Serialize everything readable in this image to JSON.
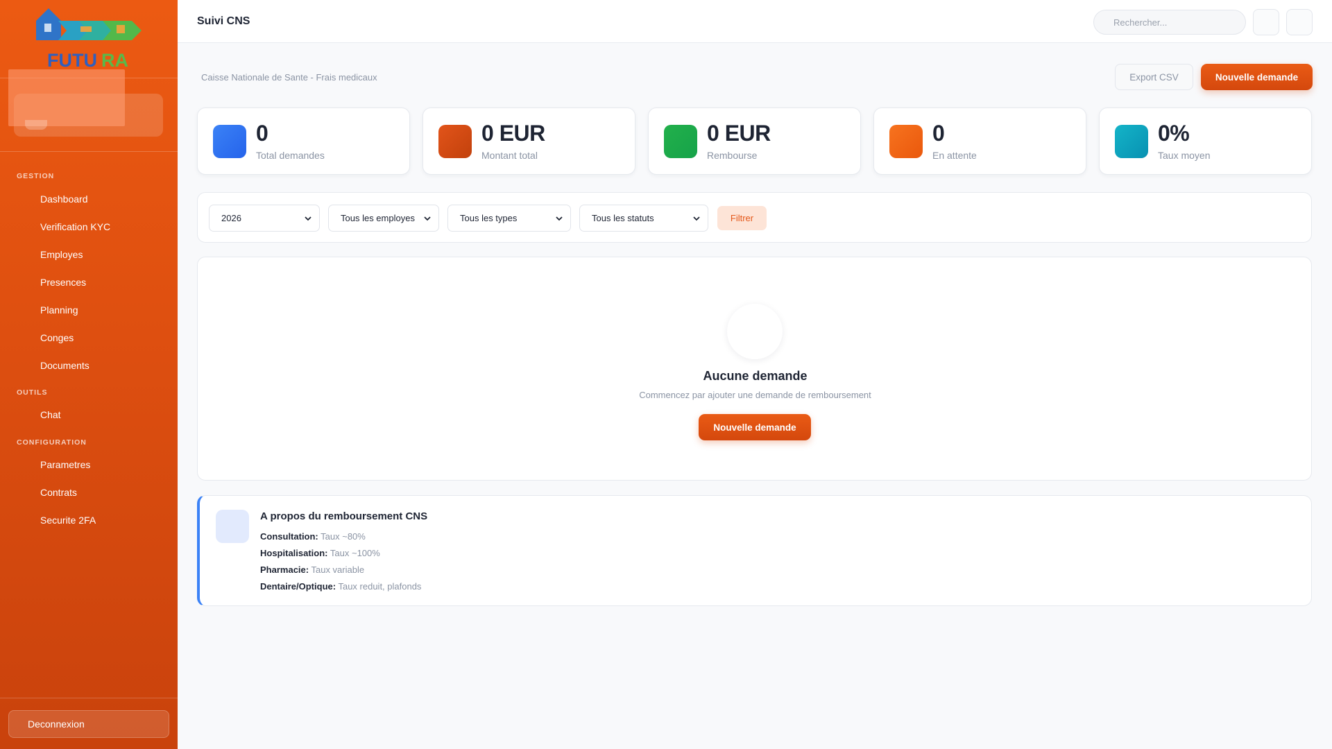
{
  "app": {
    "name": "FUTURA",
    "page_title": "Suivi CNS"
  },
  "colors": {
    "accent": "#e4581a",
    "blue": "#3b82f6",
    "green": "#22b04b",
    "teal": "#14b4c8"
  },
  "sidebar": {
    "sections": [
      {
        "label": "GESTION",
        "items": [
          {
            "label": "Dashboard"
          },
          {
            "label": "Verification KYC"
          },
          {
            "label": "Employes"
          },
          {
            "label": "Presences"
          },
          {
            "label": "Planning"
          },
          {
            "label": "Conges"
          },
          {
            "label": "Documents"
          }
        ]
      },
      {
        "label": "OUTILS",
        "items": [
          {
            "label": "Chat"
          }
        ]
      },
      {
        "label": "CONFIGURATION",
        "items": [
          {
            "label": "Parametres"
          },
          {
            "label": "Contrats"
          },
          {
            "label": "Securite 2FA"
          }
        ]
      }
    ],
    "logout_label": "Deconnexion"
  },
  "header": {
    "search_placeholder": "Rechercher..."
  },
  "main": {
    "subtitle": "Caisse Nationale de Sante - Frais medicaux",
    "export_label": "Export CSV",
    "new_request_label": "Nouvelle demande",
    "stats": [
      {
        "value": "0",
        "label": "Total demandes",
        "color": "#3b82f6"
      },
      {
        "value": "0 EUR",
        "label": "Montant total",
        "color": "#d9480f"
      },
      {
        "value": "0 EUR",
        "label": "Rembourse",
        "color": "#22b04b"
      },
      {
        "value": "0",
        "label": "En attente",
        "color": "#f26b1d"
      },
      {
        "value": "0%",
        "label": "Taux moyen",
        "color": "#14b4c8"
      }
    ],
    "filters": {
      "year": "2026",
      "employee": "Tous les employes",
      "type": "Tous les types",
      "status": "Tous les statuts",
      "filter_label": "Filtrer"
    },
    "empty": {
      "title": "Aucune demande",
      "subtitle": "Commencez par ajouter une demande de remboursement",
      "button_label": "Nouvelle demande"
    },
    "info": {
      "title": "A propos du remboursement CNS",
      "lines": [
        {
          "key": "Consultation:",
          "value": "Taux ~80%"
        },
        {
          "key": "Hospitalisation:",
          "value": "Taux ~100%"
        },
        {
          "key": "Pharmacie:",
          "value": "Taux variable"
        },
        {
          "key": "Dentaire/Optique:",
          "value": "Taux reduit, plafonds"
        }
      ]
    }
  }
}
